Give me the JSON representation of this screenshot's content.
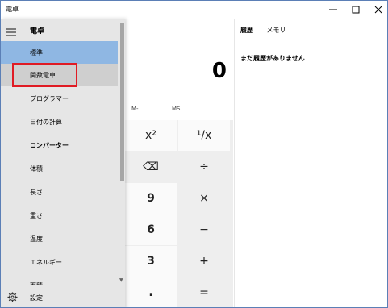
{
  "window": {
    "title": "電卓"
  },
  "nav": {
    "title": "電卓",
    "items": [
      {
        "label": "標準"
      },
      {
        "label": "関数電卓"
      },
      {
        "label": "プログラマー"
      },
      {
        "label": "日付の計算"
      },
      {
        "label": "コンバーター"
      },
      {
        "label": "体積"
      },
      {
        "label": "長さ"
      },
      {
        "label": "重さ"
      },
      {
        "label": "温度"
      },
      {
        "label": "エネルギー"
      },
      {
        "label": "面積"
      }
    ],
    "settings_label": "設定"
  },
  "display": {
    "value": "0"
  },
  "memory": {
    "minus": "M-",
    "store": "MS"
  },
  "keys": {
    "square": "x²",
    "reciprocal": "¹/x",
    "backspace": "⌫",
    "divide": "÷",
    "nine": "9",
    "multiply": "×",
    "six": "6",
    "minus": "−",
    "three": "3",
    "plus": "+",
    "decimal": ".",
    "equals": "="
  },
  "history": {
    "tab_history": "履歴",
    "tab_memory": "メモリ",
    "empty_message": "まだ履歴がありません"
  },
  "colors": {
    "selected": "#8fb7e3",
    "highlight_border": "#e01b24",
    "nav_bg": "#e6e6e6"
  }
}
